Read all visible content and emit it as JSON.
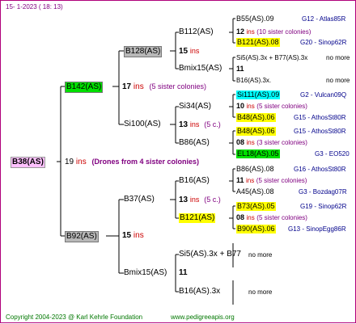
{
  "header": {
    "date": "15-  1-2023  ( 18:  13)"
  },
  "footer": {
    "copyright": "Copyright 2004-2023 @ Karl Kehrle Foundation",
    "site": "www.pedigreeapis.org"
  },
  "colors": {
    "frame": "#b0007a",
    "green": "#00e000",
    "gray": "#b8b8b8",
    "yellow": "#ffff00",
    "cyan": "#00ffff",
    "ins": "#cc0000",
    "note": "#800080",
    "group": "#00008b"
  },
  "root": {
    "name": "B38(AS)",
    "gen": "19",
    "ins": "ins",
    "note": "(Drones from 4 sister colonies)"
  },
  "father": {
    "name": "B142(AS)",
    "gen": "17",
    "ins": "ins",
    "note": "(5 sister colonies)"
  },
  "mother": {
    "name": "B92(AS)",
    "gen": "15",
    "ins": "ins"
  },
  "ff": {
    "name": "B128(AS)",
    "gen": "15",
    "ins": "ins"
  },
  "fm": {
    "name": "Si100(AS)",
    "gen": "13",
    "ins": "ins",
    "note": "(5 c.)"
  },
  "mf": {
    "name": "B37(AS)"
  },
  "mm": {
    "name": "Bmix15(AS)",
    "gen": "11"
  },
  "l3": [
    {
      "name": "B112(AS)",
      "gen": "15",
      "ins": "ins"
    },
    {
      "name": "Bmix15(AS)",
      "gen": "11"
    },
    {
      "name": "Si34(AS)",
      "gen": "13",
      "ins": "ins",
      "note": "(5 c.)"
    },
    {
      "name": "B86(AS)"
    },
    {
      "name": "B16(AS)",
      "gen": "13",
      "ins": "ins",
      "note": "(5 c.)"
    },
    {
      "name": "B121(AS)"
    },
    {
      "name": "Si5(AS).3x + B77",
      "suffix": "no more"
    },
    {
      "name": "B16(AS).3x",
      "suffix": "no more"
    }
  ],
  "l4": [
    {
      "name": "B55(AS).09",
      "group": "G12 - Atlas85R"
    },
    {
      "gen": "12",
      "ins": "ins",
      "note": "(10 sister colonies)"
    },
    {
      "name": "B121(AS).08",
      "group": "G20 - Sinop62R"
    },
    {
      "name": "Si5(AS).3x + B77(AS).3x",
      "suffix": "no more"
    },
    {
      "gen": "11"
    },
    {
      "name": "B16(AS).3x.",
      "suffix": "no more"
    },
    {
      "name": "Si111(AS).09",
      "group": "G2 - Vulcan09Q"
    },
    {
      "gen": "10",
      "ins": "ins",
      "note": "(5 sister colonies)"
    },
    {
      "name": "B48(AS).06",
      "group": "G15 - AthosSt80R"
    },
    {
      "name": "B48(AS).06",
      "group": "G15 - AthosSt80R"
    },
    {
      "gen": "08",
      "ins": "ins",
      "note": "(3 sister colonies)"
    },
    {
      "name": "EL18(AS).05",
      "group": "G3 - EO520"
    },
    {
      "name": "B86(AS).08",
      "group": "G16 - AthosSt80R"
    },
    {
      "gen": "11",
      "ins": "ins",
      "note": "(5 sister colonies)"
    },
    {
      "name": "A45(AS).08",
      "group": "G3 - Bozdag07R"
    },
    {
      "name": "B73(AS).05",
      "group": "G19 - Sinop62R"
    },
    {
      "gen": "08",
      "ins": "ins",
      "note": "(5 sister colonies)"
    },
    {
      "name": "B90(AS).06",
      "group": "G13 - SinopEgg86R"
    }
  ]
}
